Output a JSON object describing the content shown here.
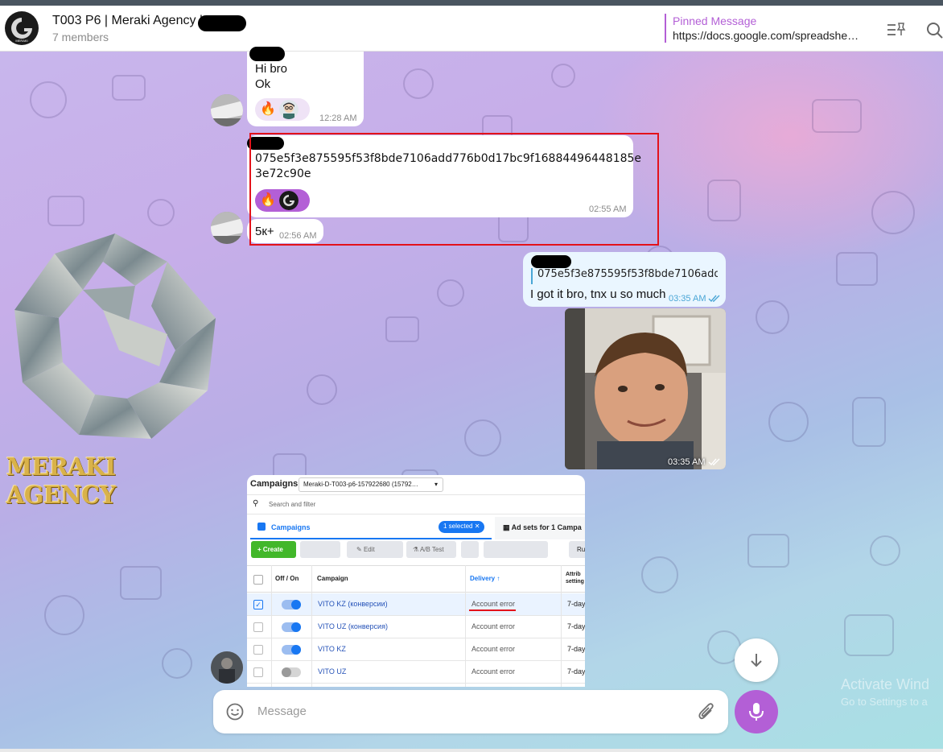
{
  "header": {
    "title": "T003 P6 | Meraki Agency |",
    "members": "7 members",
    "pinned_label": "Pinned Message",
    "pinned_text": "https://docs.google.com/spreadshe…"
  },
  "messages": [
    {
      "lines": [
        "Hi bro",
        "Ok"
      ],
      "time": "12:28 AM",
      "reaction": "🔥"
    },
    {
      "lines": [
        "075e5f3e875595f53f8bde7106add776b0d17bc9f16884496448185e",
        "3e72c90e"
      ],
      "time": "02:55 AM",
      "reaction": "🔥"
    },
    {
      "lines": [
        "5к+"
      ],
      "time": "02:56 AM"
    },
    {
      "reply_text": "075e5f3e875595f53f8bde7106add7…",
      "lines": [
        "I got it bro, tnx u so much"
      ],
      "time": "03:35 AM"
    },
    {
      "photo_time": "03:35 AM"
    }
  ],
  "logo_text": "MERAKI AGENCY",
  "screenshot": {
    "title": "Campaigns",
    "account": "Meraki-D-T003-p6-157922680 (15792…",
    "search_placeholder": "Search and filter",
    "tab_campaigns": "Campaigns",
    "selected_badge": "1 selected",
    "tab_adsets": "Ad sets for 1 Campa",
    "create": "Create",
    "edit": "Edit",
    "ab_test": "A/B Test",
    "ru": "Ru",
    "columns": [
      "Off / On",
      "Campaign",
      "Delivery ↑",
      "Attrib setting"
    ],
    "rows": [
      {
        "name": "VITO KZ (конверсии)",
        "delivery": "Account error",
        "attr": "7-day",
        "on": true,
        "checked": true
      },
      {
        "name": "VITO UZ (конверсия)",
        "delivery": "Account error",
        "attr": "7-day",
        "on": true,
        "checked": false
      },
      {
        "name": "VITO KZ",
        "delivery": "Account error",
        "attr": "7-day",
        "on": true,
        "checked": false
      },
      {
        "name": "VITO UZ",
        "delivery": "Account error",
        "attr": "7-day",
        "on": false,
        "checked": false
      }
    ]
  },
  "composer": {
    "placeholder": "Message"
  },
  "watermark": {
    "line1": "Activate Wind",
    "line2": "Go to Settings to a"
  },
  "colors": {
    "accent": "#b35fd6",
    "highlight": "#e3121a",
    "link": "#4aa6d6"
  }
}
